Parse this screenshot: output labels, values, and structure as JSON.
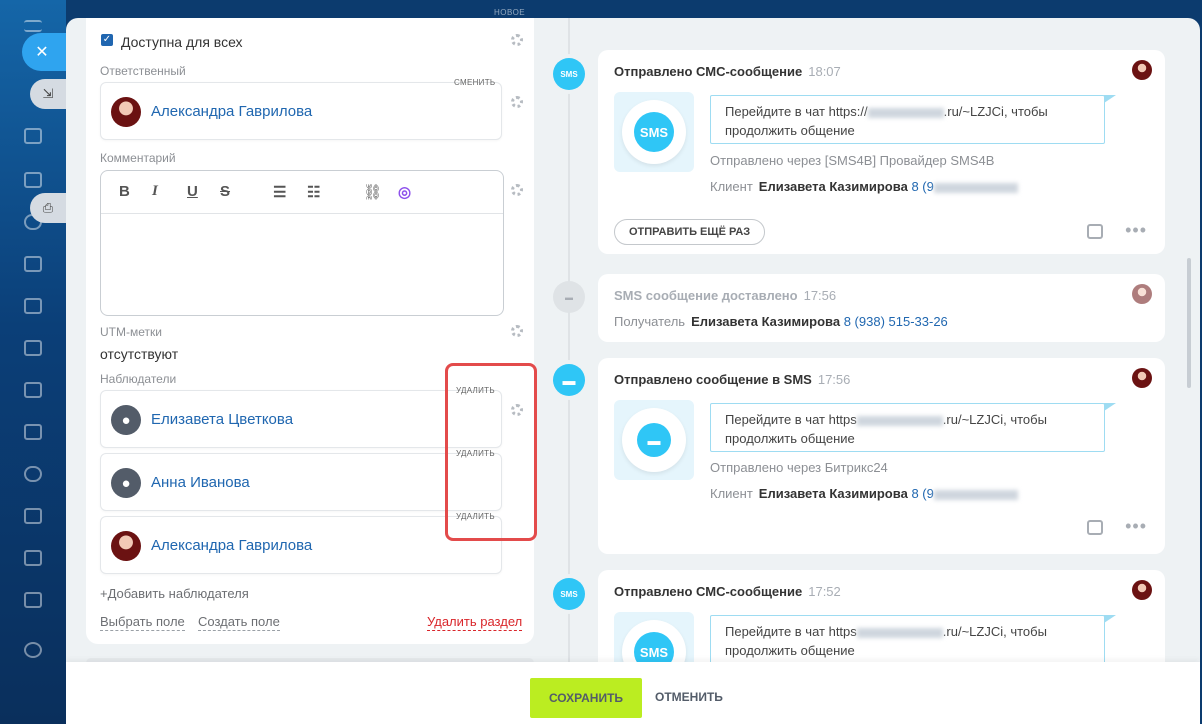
{
  "header": {
    "new_tag": "НОВОЕ"
  },
  "form": {
    "public_checkbox": {
      "label": "Доступна для всех",
      "checked": true
    },
    "responsible": {
      "label": "Ответственный",
      "change_label": "СМЕНИТЬ",
      "name": "Александра Гаврилова"
    },
    "comment": {
      "label": "Комментарий"
    },
    "utm": {
      "label": "UTM-метки",
      "value": "отсутствуют"
    },
    "observers": {
      "label": "Наблюдатели",
      "delete_label": "УДАЛИТЬ",
      "items": [
        {
          "name": "Елизавета Цветкова",
          "avatar": "generic"
        },
        {
          "name": "Анна Иванова",
          "avatar": "generic"
        },
        {
          "name": "Александра Гаврилова",
          "avatar": "photo"
        }
      ],
      "add_label": "+Добавить наблюдателя"
    },
    "select_field": "Выбрать поле",
    "create_field": "Создать поле",
    "delete_section": "Удалить раздел"
  },
  "editor_toolbar": [
    "bold-icon",
    "italic-icon",
    "underline-icon",
    "strikethrough-icon",
    "numbered-list-icon",
    "bullet-list-icon",
    "link-icon",
    "copilot-icon"
  ],
  "timeline": [
    {
      "title": "Отправлено СМС-сообщение",
      "time": "18:07",
      "icon_text": "SMS",
      "message_start": "Перейдите в чат https://",
      "message_end": ".ru/~LZJCi, чтобы",
      "message_line2": "продолжить общение",
      "via": "Отправлено через [SMS4B] Провайдер SMS4B",
      "client_label": "Клиент",
      "client_name": "Елизавета Казимирова",
      "phone_prefix": "8 (9",
      "resend_label": "ОТПРАВИТЬ ЕЩЁ РАЗ"
    },
    {
      "title": "SMS сообщение доставлено",
      "time": "17:56",
      "recipient_label": "Получатель",
      "recipient_name": "Елизавета Казимирова",
      "phone": "8 (938) 515-33-26"
    },
    {
      "title": "Отправлено сообщение в SMS",
      "time": "17:56",
      "message_start": "Перейдите в чат https",
      "message_end": ".ru/~LZJCi, чтобы",
      "message_line2": "продолжить общение",
      "via": "Отправлено через Битрикс24",
      "client_label": "Клиент",
      "client_name": "Елизавета Казимирова",
      "phone_prefix": "8 (9"
    },
    {
      "title": "Отправлено СМС-сообщение",
      "time": "17:52",
      "icon_text": "SMS",
      "message_start": "Перейдите в чат https",
      "message_end": ".ru/~LZJCi, чтобы",
      "message_line2": "продолжить общение"
    }
  ],
  "footer": {
    "save_label": "СОХРАНИТЬ",
    "cancel_label": "ОТМЕНИТЬ"
  },
  "colors": {
    "accent": "#2fc6f6",
    "link": "#2067b0",
    "save": "#bbed21",
    "highlight": "#e34b4b"
  }
}
